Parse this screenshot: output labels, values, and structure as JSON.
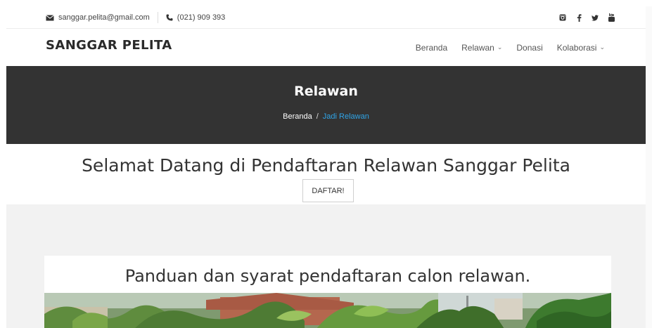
{
  "topbar": {
    "email": "sanggar.pelita@gmail.com",
    "phone": "(021) 909 393",
    "social": [
      "instagram-icon",
      "facebook-icon",
      "twitter-icon",
      "youtube-icon"
    ]
  },
  "header": {
    "brand": "SANGGAR PELITA",
    "nav": [
      {
        "label": "Beranda",
        "dropdown": false
      },
      {
        "label": "Relawan",
        "dropdown": true
      },
      {
        "label": "Donasi",
        "dropdown": false
      },
      {
        "label": "Kolaborasi",
        "dropdown": true
      }
    ]
  },
  "banner": {
    "title": "Relawan",
    "breadcrumb_home": "Beranda",
    "breadcrumb_separator": "/",
    "breadcrumb_current": "Jadi Relawan",
    "breadcrumb_current_color": "#2fa4e7"
  },
  "welcome": {
    "heading": "Selamat Datang di Pendaftaran Relawan Sanggar Pelita",
    "button": "DAFTAR!"
  },
  "guide": {
    "title": "Panduan dan syarat pendaftaran calon relawan."
  },
  "colors": {
    "banner_bg": "#333333",
    "section_bg": "#f2f2f2",
    "accent": "#2fa4e7"
  }
}
